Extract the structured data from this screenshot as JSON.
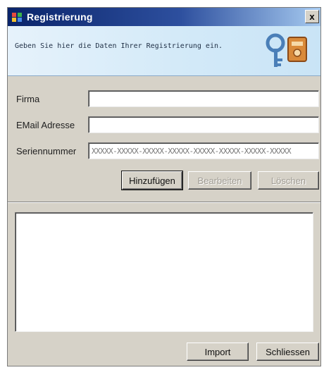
{
  "window": {
    "title": "Registrierung",
    "close_glyph": "x"
  },
  "header": {
    "instruction": "Geben Sie hier die Daten Ihrer Registrierung ein.",
    "icon": "keys-icon"
  },
  "form": {
    "company_label": "Firma",
    "company_value": "",
    "email_label": "EMail Adresse",
    "email_value": "",
    "serial_label": "Seriennummer",
    "serial_value": "XXXXX-XXXXX-XXXXX-XXXXX-XXXXX-XXXXX-XXXXX-XXXXX"
  },
  "actions": {
    "add_label": "Hinzufügen",
    "edit_label": "Bearbeiten",
    "delete_label": "Löschen"
  },
  "footer": {
    "import_label": "Import",
    "close_label": "Schliessen"
  },
  "colors": {
    "titlebar": "#0a246a",
    "dialog_face": "#d6d2c8",
    "banner": "#d2e9f8"
  }
}
